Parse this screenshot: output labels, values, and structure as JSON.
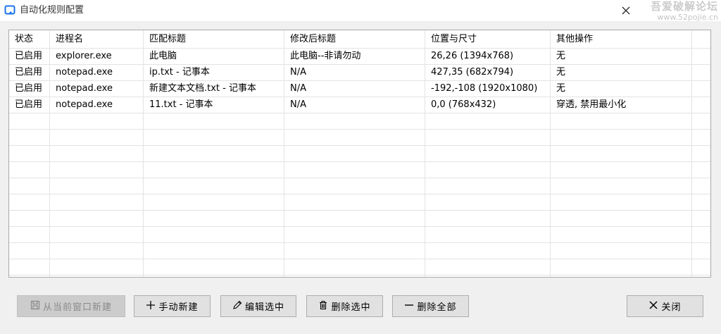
{
  "window": {
    "title": "自动化规则配置",
    "watermark_main": "吾爱破解论坛",
    "watermark_sub": "www.52pojie.cn"
  },
  "table": {
    "columns": [
      "状态",
      "进程名",
      "匹配标题",
      "修改后标题",
      "位置与尺寸",
      "其他操作"
    ],
    "rows": [
      [
        "已启用",
        "explorer.exe",
        "此电脑",
        "此电脑--非请勿动",
        "26,26 (1394x768)",
        "无"
      ],
      [
        "已启用",
        "notepad.exe",
        "ip.txt - 记事本",
        "N/A",
        "427,35 (682x794)",
        "无"
      ],
      [
        "已启用",
        "notepad.exe",
        "新建文本文档.txt - 记事本",
        "N/A",
        "-192,-108 (1920x1080)",
        "无"
      ],
      [
        "已启用",
        "notepad.exe",
        "11.txt - 记事本",
        "N/A",
        "0,0 (768x432)",
        "穿透, 禁用最小化"
      ]
    ]
  },
  "buttons": {
    "new_from_window": "从当前窗口新建",
    "manual_new": "手动新建",
    "edit_selected": "编辑选中",
    "delete_selected": "删除选中",
    "delete_all": "删除全部",
    "close": "关闭"
  },
  "icons": {
    "app": "window-edit-icon",
    "new_from_window": "save-disk-icon",
    "manual_new": "plus-icon",
    "edit_selected": "pencil-icon",
    "delete_selected": "trash-icon",
    "delete_all": "minus-icon",
    "close": "x-icon"
  },
  "colors": {
    "accent": "#1a73e8",
    "grid": "#e3e3e3",
    "disabled_bg": "#cccccc"
  }
}
